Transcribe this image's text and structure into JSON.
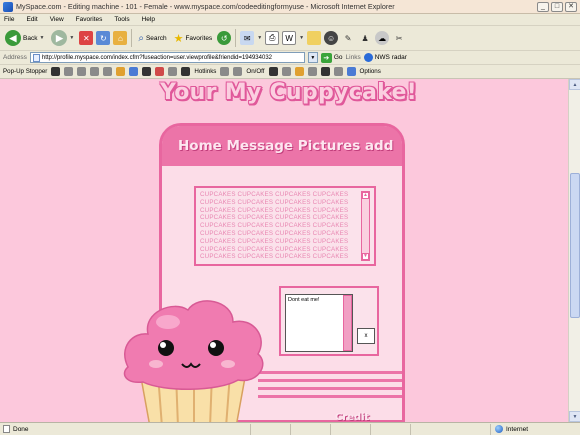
{
  "window": {
    "title": "MySpace.com - Editing machine - 101 - Female - www.myspace.com/codeeditingformyuse - Microsoft Internet Explorer",
    "minimize": "_",
    "maximize": "□",
    "close": "✕"
  },
  "menu": [
    "File",
    "Edit",
    "View",
    "Favorites",
    "Tools",
    "Help"
  ],
  "toolbar": {
    "back": "Back",
    "search": "Search",
    "favorites": "Favorites"
  },
  "address": {
    "label": "Address",
    "url": "http://profile.myspace.com/index.cfm?fuseaction=user.viewprofile&friendid=194934032",
    "go": "Go",
    "links": "Links",
    "nws": "NWS radar"
  },
  "popup_bar": {
    "label": "Pop-Up Stopper",
    "hotlinks": "Hotlinks",
    "onoff": "On/Off",
    "options": "Options"
  },
  "page": {
    "banner": "Your My Cuppycake!",
    "nav": "Home Message Pictures add",
    "scroll_text": "CUPCAKES CUPCAKES CUPCAKES CUPCAKES CUPCAKES CUPCAKES CUPCAKES CUPCAKES CUPCAKES CUPCAKES CUPCAKES CUPCAKES CUPCAKES CUPCAKES CUPCAKES CUPCAKES CUPCAKES CUPCAKES CUPCAKES CUPCAKES CUPCAKES CUPCAKES CUPCAKES CUPCAKES CUPCAKES CUPCAKES CUPCAKES CUPCAKES CUPCAKES CUPCAKES CUPCAKES CUPCAKES CUPCAKES CUPCAKES CUPCAKES CUPCAKES CUPCAKES CUPCAKES",
    "comment_text": "Dont eat me!",
    "close_label": "x",
    "credit": "Credit"
  },
  "status": {
    "text": "Done",
    "zone": "Internet"
  },
  "colors": {
    "page_bg": "#fcc8dc",
    "accent": "#e8669f",
    "header_pink": "#ec74a8"
  }
}
